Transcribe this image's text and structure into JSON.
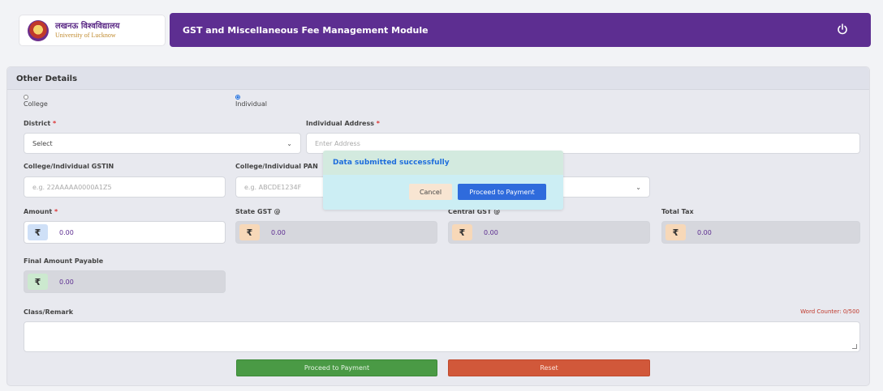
{
  "logo": {
    "hindi": "लखनऊ विश्वविद्यालय",
    "english": "University of Lucknow"
  },
  "header": {
    "title": "GST and Miscellaneous Fee Management Module"
  },
  "form": {
    "section_title": "Other Details",
    "radio_college": "College",
    "radio_individual": "Individual",
    "district_label": "District",
    "district_value": "Select",
    "address_label": "Individual Address",
    "address_placeholder": "Enter Address",
    "gstin_label": "College/Individual GSTIN",
    "gstin_placeholder": "e.g. 22AAAAA0000A1Z5",
    "pan_label": "College/Individual PAN",
    "pan_placeholder": "e.g. ABCDE1234F",
    "amount_label": "Amount",
    "state_gst_label": "State GST @",
    "central_gst_label": "Central GST @",
    "total_tax_label": "Total Tax",
    "final_amount_label": "Final Amount Payable",
    "currency_symbol": "₹",
    "amount_value": "0.00",
    "state_gst_value": "0.00",
    "central_gst_value": "0.00",
    "total_tax_value": "0.00",
    "final_amount_value": "0.00",
    "remark_label": "Class/Remark",
    "word_counter": "Word Counter: 0/500",
    "required_mark": "*",
    "proceed_label": "Proceed to Payment",
    "reset_label": "Reset"
  },
  "modal": {
    "message": "Data submitted successfully",
    "cancel_label": "Cancel",
    "proceed_label": "Proceed to Payment"
  },
  "colors": {
    "brand_purple": "#5d2e91",
    "success_green": "#4a9a45",
    "reset_orange": "#d1583a",
    "primary_blue": "#2f6bdc"
  }
}
